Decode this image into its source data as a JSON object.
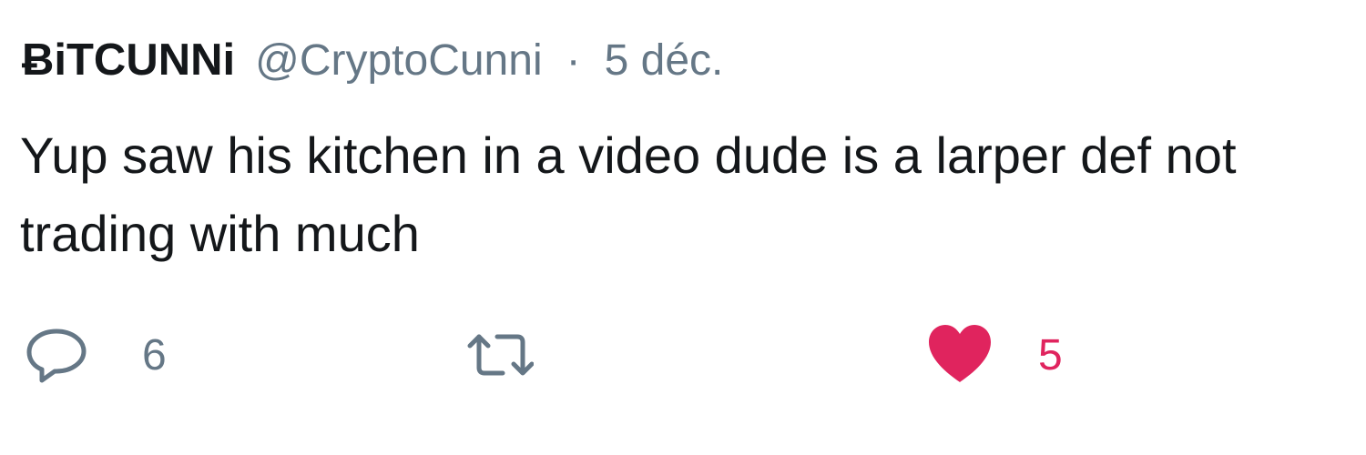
{
  "tweet": {
    "display_name": "ɃiTCUNNi",
    "handle": "@CryptoCunni",
    "separator": "·",
    "date": "5 déc.",
    "text": "Yup saw his kitchen in a video dude is a larper def not trading with much"
  },
  "actions": {
    "reply": {
      "icon": "reply-bubble-icon",
      "count": "6"
    },
    "retweet": {
      "icon": "retweet-icon",
      "count": ""
    },
    "like": {
      "icon": "heart-icon",
      "count": "5"
    }
  },
  "colors": {
    "text": "#14171a",
    "secondary": "#657786",
    "like": "#e0245e",
    "background": "#ffffff"
  }
}
